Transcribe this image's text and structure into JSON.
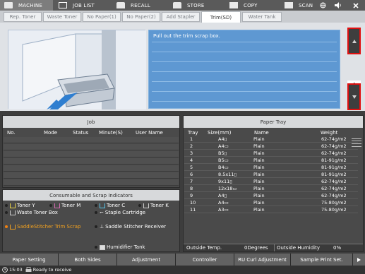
{
  "topbar": {
    "items": [
      {
        "label": "MACHINE",
        "icon": "machine-icon"
      },
      {
        "label": "JOB LIST",
        "icon": "job-list-icon"
      },
      {
        "label": "RECALL",
        "icon": "recall-icon"
      },
      {
        "label": "STORE",
        "icon": "store-icon"
      },
      {
        "label": "COPY",
        "icon": "copy-icon"
      },
      {
        "label": "SCAN",
        "icon": "scan-icon"
      }
    ]
  },
  "tabs": [
    "Rep. Toner",
    "Waste Toner",
    "No Paper(1)",
    "No Paper(2)",
    "Add Stapler",
    "Trim(SD)",
    "Water Tank"
  ],
  "message": "Pull out the trim scrap box.",
  "pager": {
    "current": "1",
    "total": "5"
  },
  "job": {
    "title": "Job",
    "columns": [
      "No.",
      "Mode",
      "Status",
      "Minute(S)",
      "User Name"
    ]
  },
  "consumables": {
    "title": "Consumable and Scrap Indicators",
    "items": [
      "Toner Y",
      "Toner M",
      "Toner C",
      "Toner K",
      "Waste Toner Box",
      "Staple Cartridge",
      "SaddleStitcher Trim Scrap",
      "Saddle Stitcher Receiver",
      "Humidifier Tank"
    ]
  },
  "paper_tray": {
    "title": "Paper Tray",
    "columns": [
      "Tray",
      "Size(mm)",
      "Name",
      "Weight"
    ],
    "rows": [
      {
        "tray": "1",
        "size": "A4▯",
        "name": "Plain",
        "weight": "62-74g/m2"
      },
      {
        "tray": "2",
        "size": "A4▭",
        "name": "Plain",
        "weight": "62-74g/m2"
      },
      {
        "tray": "3",
        "size": "B5▯",
        "name": "Plain",
        "weight": "62-74g/m2"
      },
      {
        "tray": "4",
        "size": "B5▭",
        "name": "Plain",
        "weight": "81-91g/m2"
      },
      {
        "tray": "5",
        "size": "B4▭",
        "name": "Plain",
        "weight": "81-91g/m2"
      },
      {
        "tray": "6",
        "size": "8.5x11▯",
        "name": "Plain",
        "weight": "81-91g/m2"
      },
      {
        "tray": "7",
        "size": "9x11▯",
        "name": "Plain",
        "weight": "62-74g/m2"
      },
      {
        "tray": "8",
        "size": "12x18▭",
        "name": "Plain",
        "weight": "62-74g/m2"
      },
      {
        "tray": "9",
        "size": "A4▯",
        "name": "Plain",
        "weight": "62-74g/m2"
      },
      {
        "tray": "10",
        "size": "A4▭",
        "name": "Plain",
        "weight": "75-80g/m2"
      },
      {
        "tray": "11",
        "size": "A3▭",
        "name": "Plain",
        "weight": "75-80g/m2"
      }
    ],
    "outside_temp_label": "Outside Temp.",
    "outside_temp_value": "0Degrees",
    "outside_humidity_label": "Outside Humidity",
    "outside_humidity_value": "0%"
  },
  "footer": [
    "Paper Setting",
    "Both Sides",
    "Adjustment",
    "Controller",
    "RU Curl Adjustment",
    "Sample Print Set."
  ],
  "status": {
    "time": "15:03",
    "text": "Ready to receive"
  }
}
